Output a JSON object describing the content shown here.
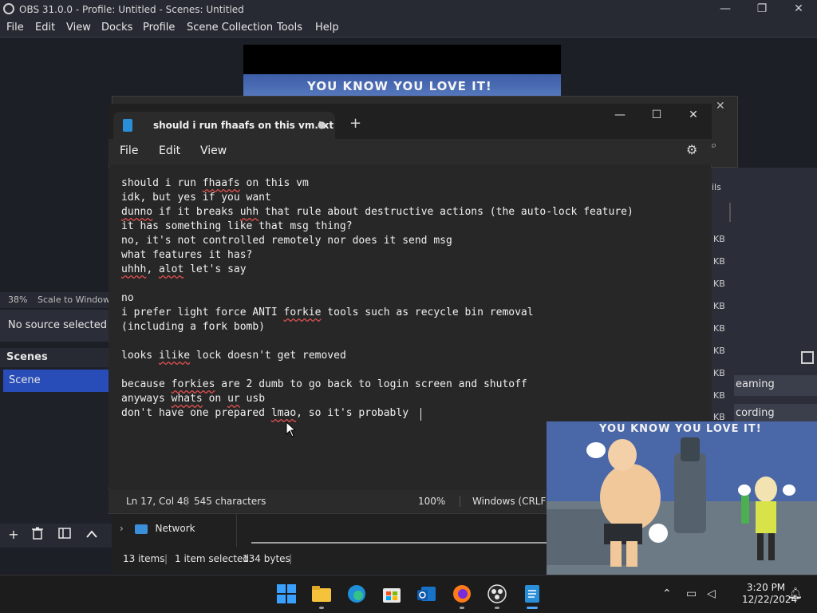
{
  "obs": {
    "title": "OBS 31.0.0 - Profile: Untitled - Scenes: Untitled",
    "menu": [
      "File",
      "Edit",
      "View",
      "Docks",
      "Profile",
      "Scene Collection",
      "Tools",
      "Help"
    ],
    "preview_caption": "YOU KNOW YOU LOVE IT!",
    "scale_pct": "38%",
    "scale_label": "Scale to Window",
    "no_source": "No source selected",
    "scenes_header": "Scenes",
    "scene_item": "Scene",
    "right_panel_fragment": "ils",
    "file_sizes": [
      "KB",
      "KB",
      "KB",
      "KB",
      "KB",
      "KB",
      "KB",
      "KB",
      "KB"
    ],
    "streaming_label": "eaming",
    "recording_label": "cording"
  },
  "notepad": {
    "tab_title": "should i run fhaafs on this vm.txt",
    "menu": [
      "File",
      "Edit",
      "View"
    ],
    "lines": [
      "should i run fhaafs on this vm",
      "idk, but yes if you want",
      "dunno if it breaks uhh that rule about destructive actions (the auto-lock feature)",
      "it has something like that msg thing?",
      "no, it's not controlled remotely nor does it send msg",
      "what features it has?",
      "uhhh, alot let's say",
      "",
      "no",
      "i prefer light force ANTI forkie tools such as recycle bin removal",
      "(including a fork bomb)",
      "",
      "looks ilike lock doesn't get removed",
      "",
      "because forkies are 2 dumb to go back to login screen and shutoff",
      "anyways whats on ur usb",
      "don't have one prepared lmao, so it's probably "
    ],
    "status": {
      "position": "Ln 17, Col 48",
      "characters": "545 characters",
      "zoom": "100%",
      "line_ending": "Windows (CRLF)"
    }
  },
  "explorer": {
    "nav_item": "Network",
    "items": "13 items",
    "selected": "1 item selected",
    "size": "134 bytes"
  },
  "video": {
    "caption": "YOU KNOW YOU LOVE IT!"
  },
  "taskbar": {
    "time": "3:20 PM",
    "date": "12/22/2024"
  }
}
